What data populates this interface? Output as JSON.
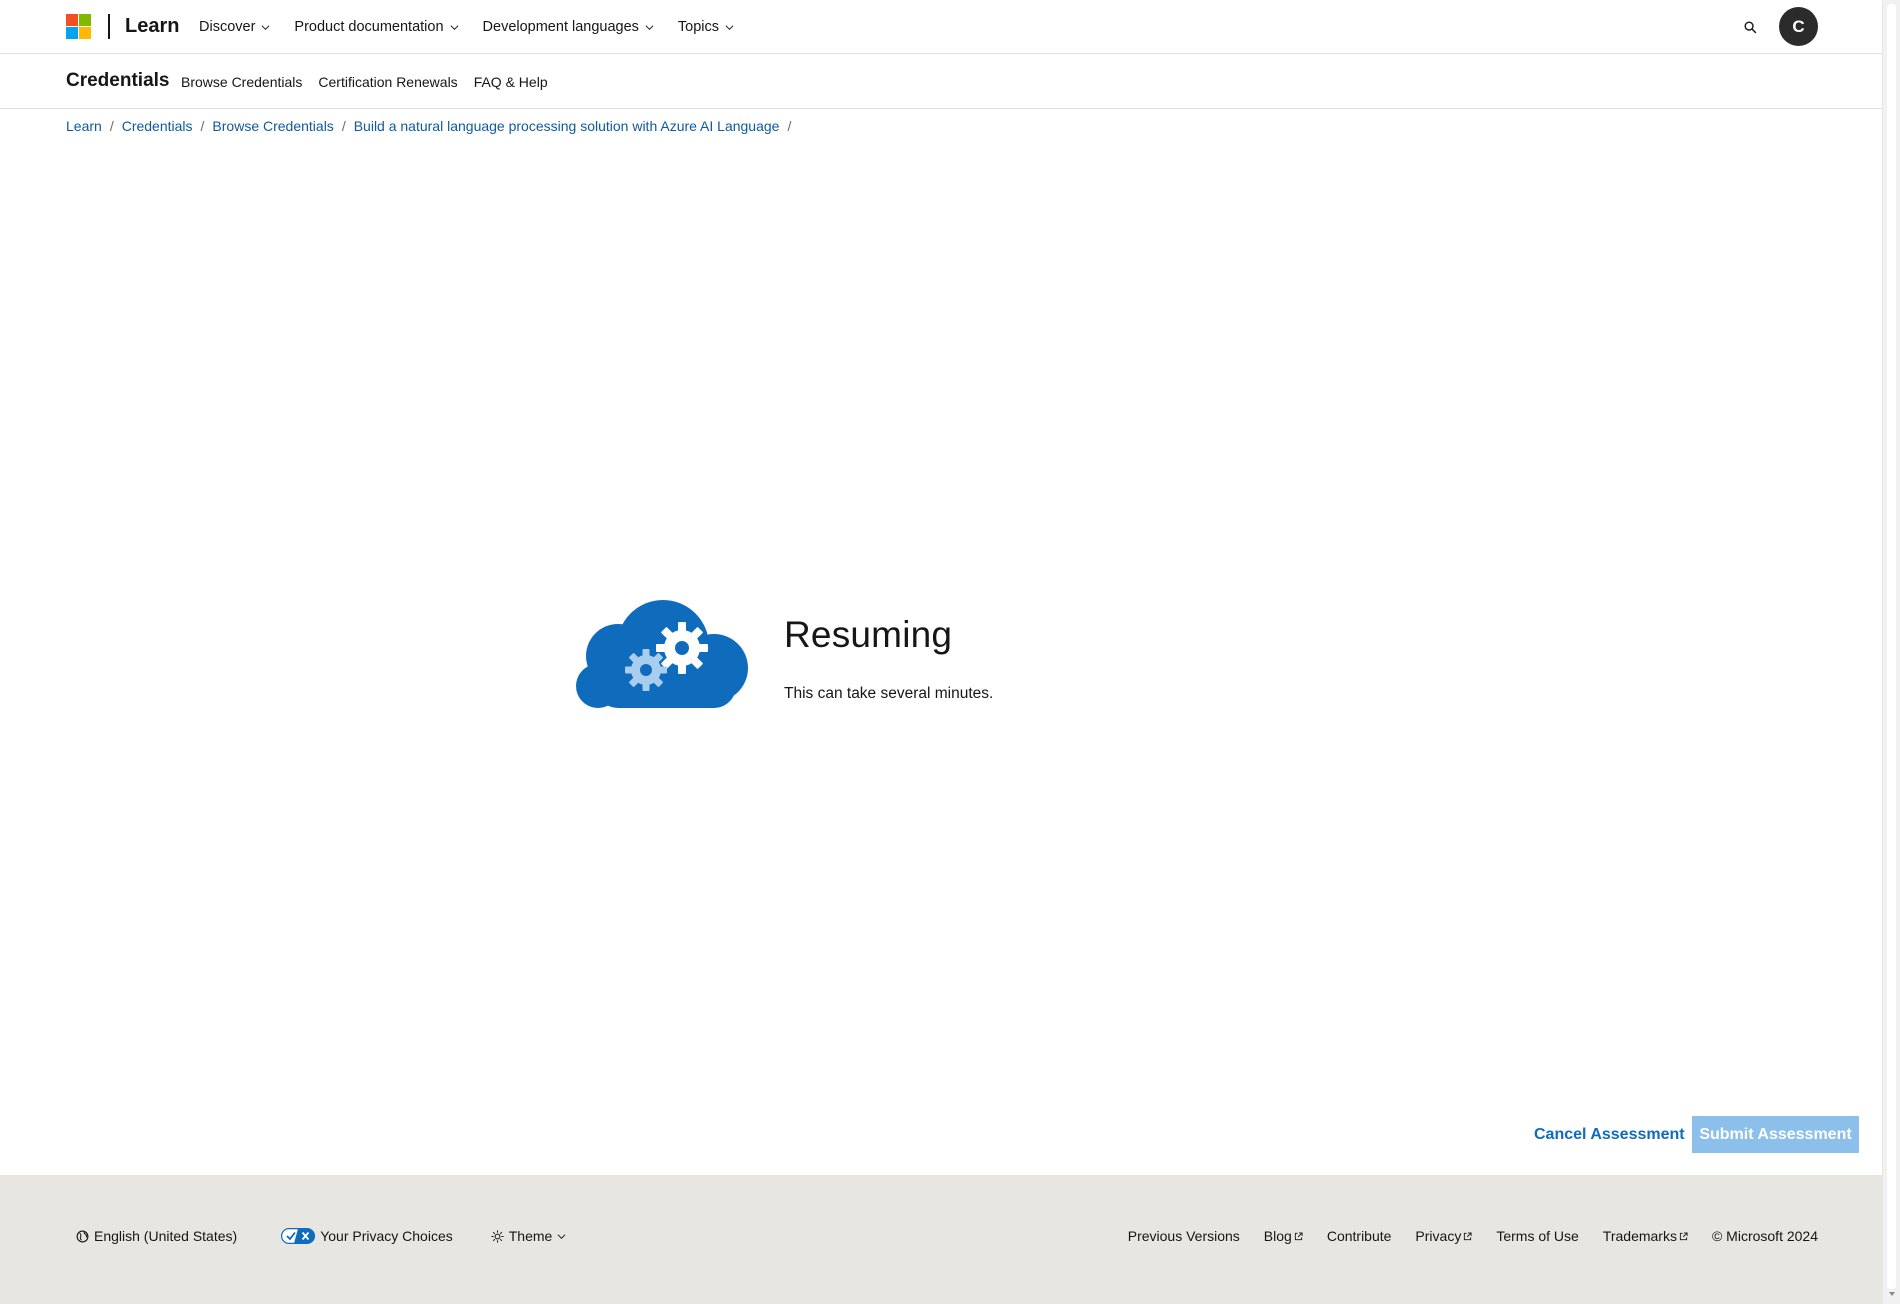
{
  "header": {
    "brand": "Learn",
    "nav": [
      {
        "label": "Discover"
      },
      {
        "label": "Product documentation"
      },
      {
        "label": "Development languages"
      },
      {
        "label": "Topics"
      }
    ],
    "avatar_initial": "C"
  },
  "subnav": {
    "title": "Credentials",
    "links": [
      {
        "label": "Browse Credentials"
      },
      {
        "label": "Certification Renewals"
      },
      {
        "label": "FAQ & Help"
      }
    ]
  },
  "breadcrumb": [
    {
      "label": "Learn"
    },
    {
      "label": "Credentials"
    },
    {
      "label": "Browse Credentials"
    },
    {
      "label": "Build a natural language processing solution with Azure AI Language"
    }
  ],
  "loader": {
    "title": "Resuming",
    "subtitle": "This can take several minutes."
  },
  "actions": {
    "cancel_label": "Cancel Assessment",
    "submit_label": "Submit Assessment"
  },
  "footer": {
    "language": "English (United States)",
    "privacy_choices": "Your Privacy Choices",
    "theme": "Theme",
    "links": [
      {
        "label": "Previous Versions",
        "external": false
      },
      {
        "label": "Blog",
        "external": true
      },
      {
        "label": "Contribute",
        "external": false
      },
      {
        "label": "Privacy",
        "external": true
      },
      {
        "label": "Terms of Use",
        "external": false
      },
      {
        "label": "Trademarks",
        "external": true
      }
    ],
    "copyright": "© Microsoft 2024"
  },
  "colors": {
    "link": "#0f5a9c",
    "accent": "#0f6cbd",
    "cloud": "#0f6cbd",
    "submit_disabled": "#8cbfea",
    "footer_bg": "#e8e6e1"
  },
  "icons": {
    "logo": "microsoft-logo",
    "search": "search-icon",
    "cloud": "cloud-gears-icon",
    "globe": "globe-icon",
    "privacy": "privacy-toggle-icon",
    "theme": "sun-icon",
    "external": "external-link-icon"
  }
}
